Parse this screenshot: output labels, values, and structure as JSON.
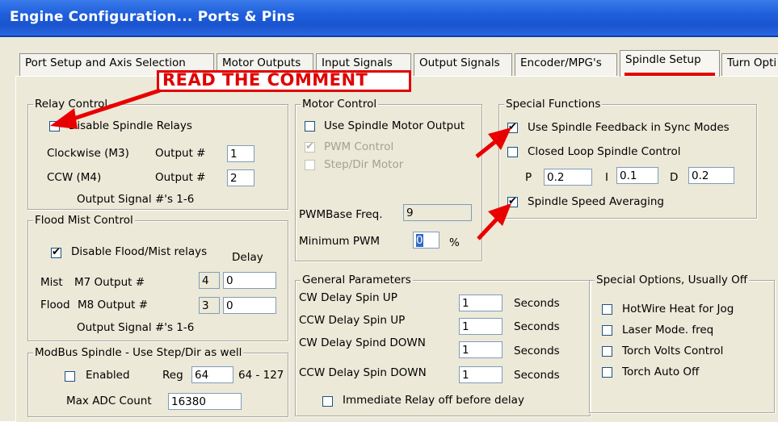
{
  "window": {
    "title": "Engine Configuration... Ports & Pins"
  },
  "tabs": [
    {
      "label": "Port Setup and Axis Selection"
    },
    {
      "label": "Motor Outputs"
    },
    {
      "label": "Input Signals"
    },
    {
      "label": "Output Signals"
    },
    {
      "label": "Encoder/MPG's"
    },
    {
      "label": "Spindle Setup"
    },
    {
      "label": "Turn Opti"
    }
  ],
  "annotation": {
    "text": "READ THE COMMENT",
    "color": "#e00000"
  },
  "relay": {
    "title": "Relay Control",
    "disable_label": "Disable Spindle Relays",
    "disable_checked": false,
    "cw_label": "Clockwise (M3)",
    "ccw_label": "CCW (M4)",
    "output_label": "Output #",
    "cw_output": "1",
    "ccw_output": "2",
    "note": "Output Signal #'s 1-6"
  },
  "flood": {
    "title": "Flood Mist Control",
    "disable_label": "Disable Flood/Mist relays",
    "disable_checked": true,
    "delay_label": "Delay",
    "mist_label": "Mist",
    "mist_output_label": "M7 Output #",
    "mist_output": "4",
    "mist_delay": "0",
    "flood_label": "Flood",
    "flood_output_label": "M8 Output #",
    "flood_output": "3",
    "flood_delay": "0",
    "note": "Output Signal #'s 1-6"
  },
  "modbus": {
    "title": "ModBus Spindle - Use Step/Dir as well",
    "enabled_label": "Enabled",
    "enabled_checked": false,
    "reg_label": "Reg",
    "reg_value": "64",
    "reg_range": "64 - 127",
    "max_adc_label": "Max ADC Count",
    "max_adc_value": "16380"
  },
  "motor": {
    "title": "Motor Control",
    "use_motor_label": "Use Spindle Motor Output",
    "use_motor_checked": false,
    "pwm_label": "PWM Control",
    "pwm_checked": true,
    "stepdir_label": "Step/Dir Motor",
    "stepdir_checked": false,
    "pwm_base_label": "PWMBase Freq.",
    "pwm_base_value": "9",
    "min_pwm_label": "Minimum PWM",
    "min_pwm_value": "0",
    "min_pwm_unit": "%"
  },
  "special": {
    "title": "Special Functions",
    "feedback_label": "Use Spindle Feedback in Sync Modes",
    "feedback_checked": true,
    "closed_loop_label": "Closed Loop Spindle Control",
    "closed_loop_checked": false,
    "p_label": "P",
    "p_value": "0.2",
    "i_label": "I",
    "i_value": "0.1",
    "d_label": "D",
    "d_value": "0.2",
    "averaging_label": "Spindle Speed Averaging",
    "averaging_checked": true
  },
  "general": {
    "title": "General Parameters",
    "rows": [
      {
        "label": "CW Delay Spin UP",
        "value": "1",
        "unit": "Seconds"
      },
      {
        "label": "CCW Delay Spin UP",
        "value": "1",
        "unit": "Seconds"
      },
      {
        "label": "CW Delay Spind DOWN",
        "value": "1",
        "unit": "Seconds"
      },
      {
        "label": "CCW Delay Spin DOWN",
        "value": "1",
        "unit": "Seconds"
      }
    ],
    "immediate_label": "Immediate Relay off before delay",
    "immediate_checked": false
  },
  "options": {
    "title": "Special Options, Usually Off",
    "items": [
      {
        "label": "HotWire Heat for Jog",
        "checked": false
      },
      {
        "label": "Laser Mode. freq",
        "checked": false
      },
      {
        "label": "Torch Volts Control",
        "checked": false
      },
      {
        "label": "Torch Auto Off",
        "checked": false
      }
    ]
  }
}
